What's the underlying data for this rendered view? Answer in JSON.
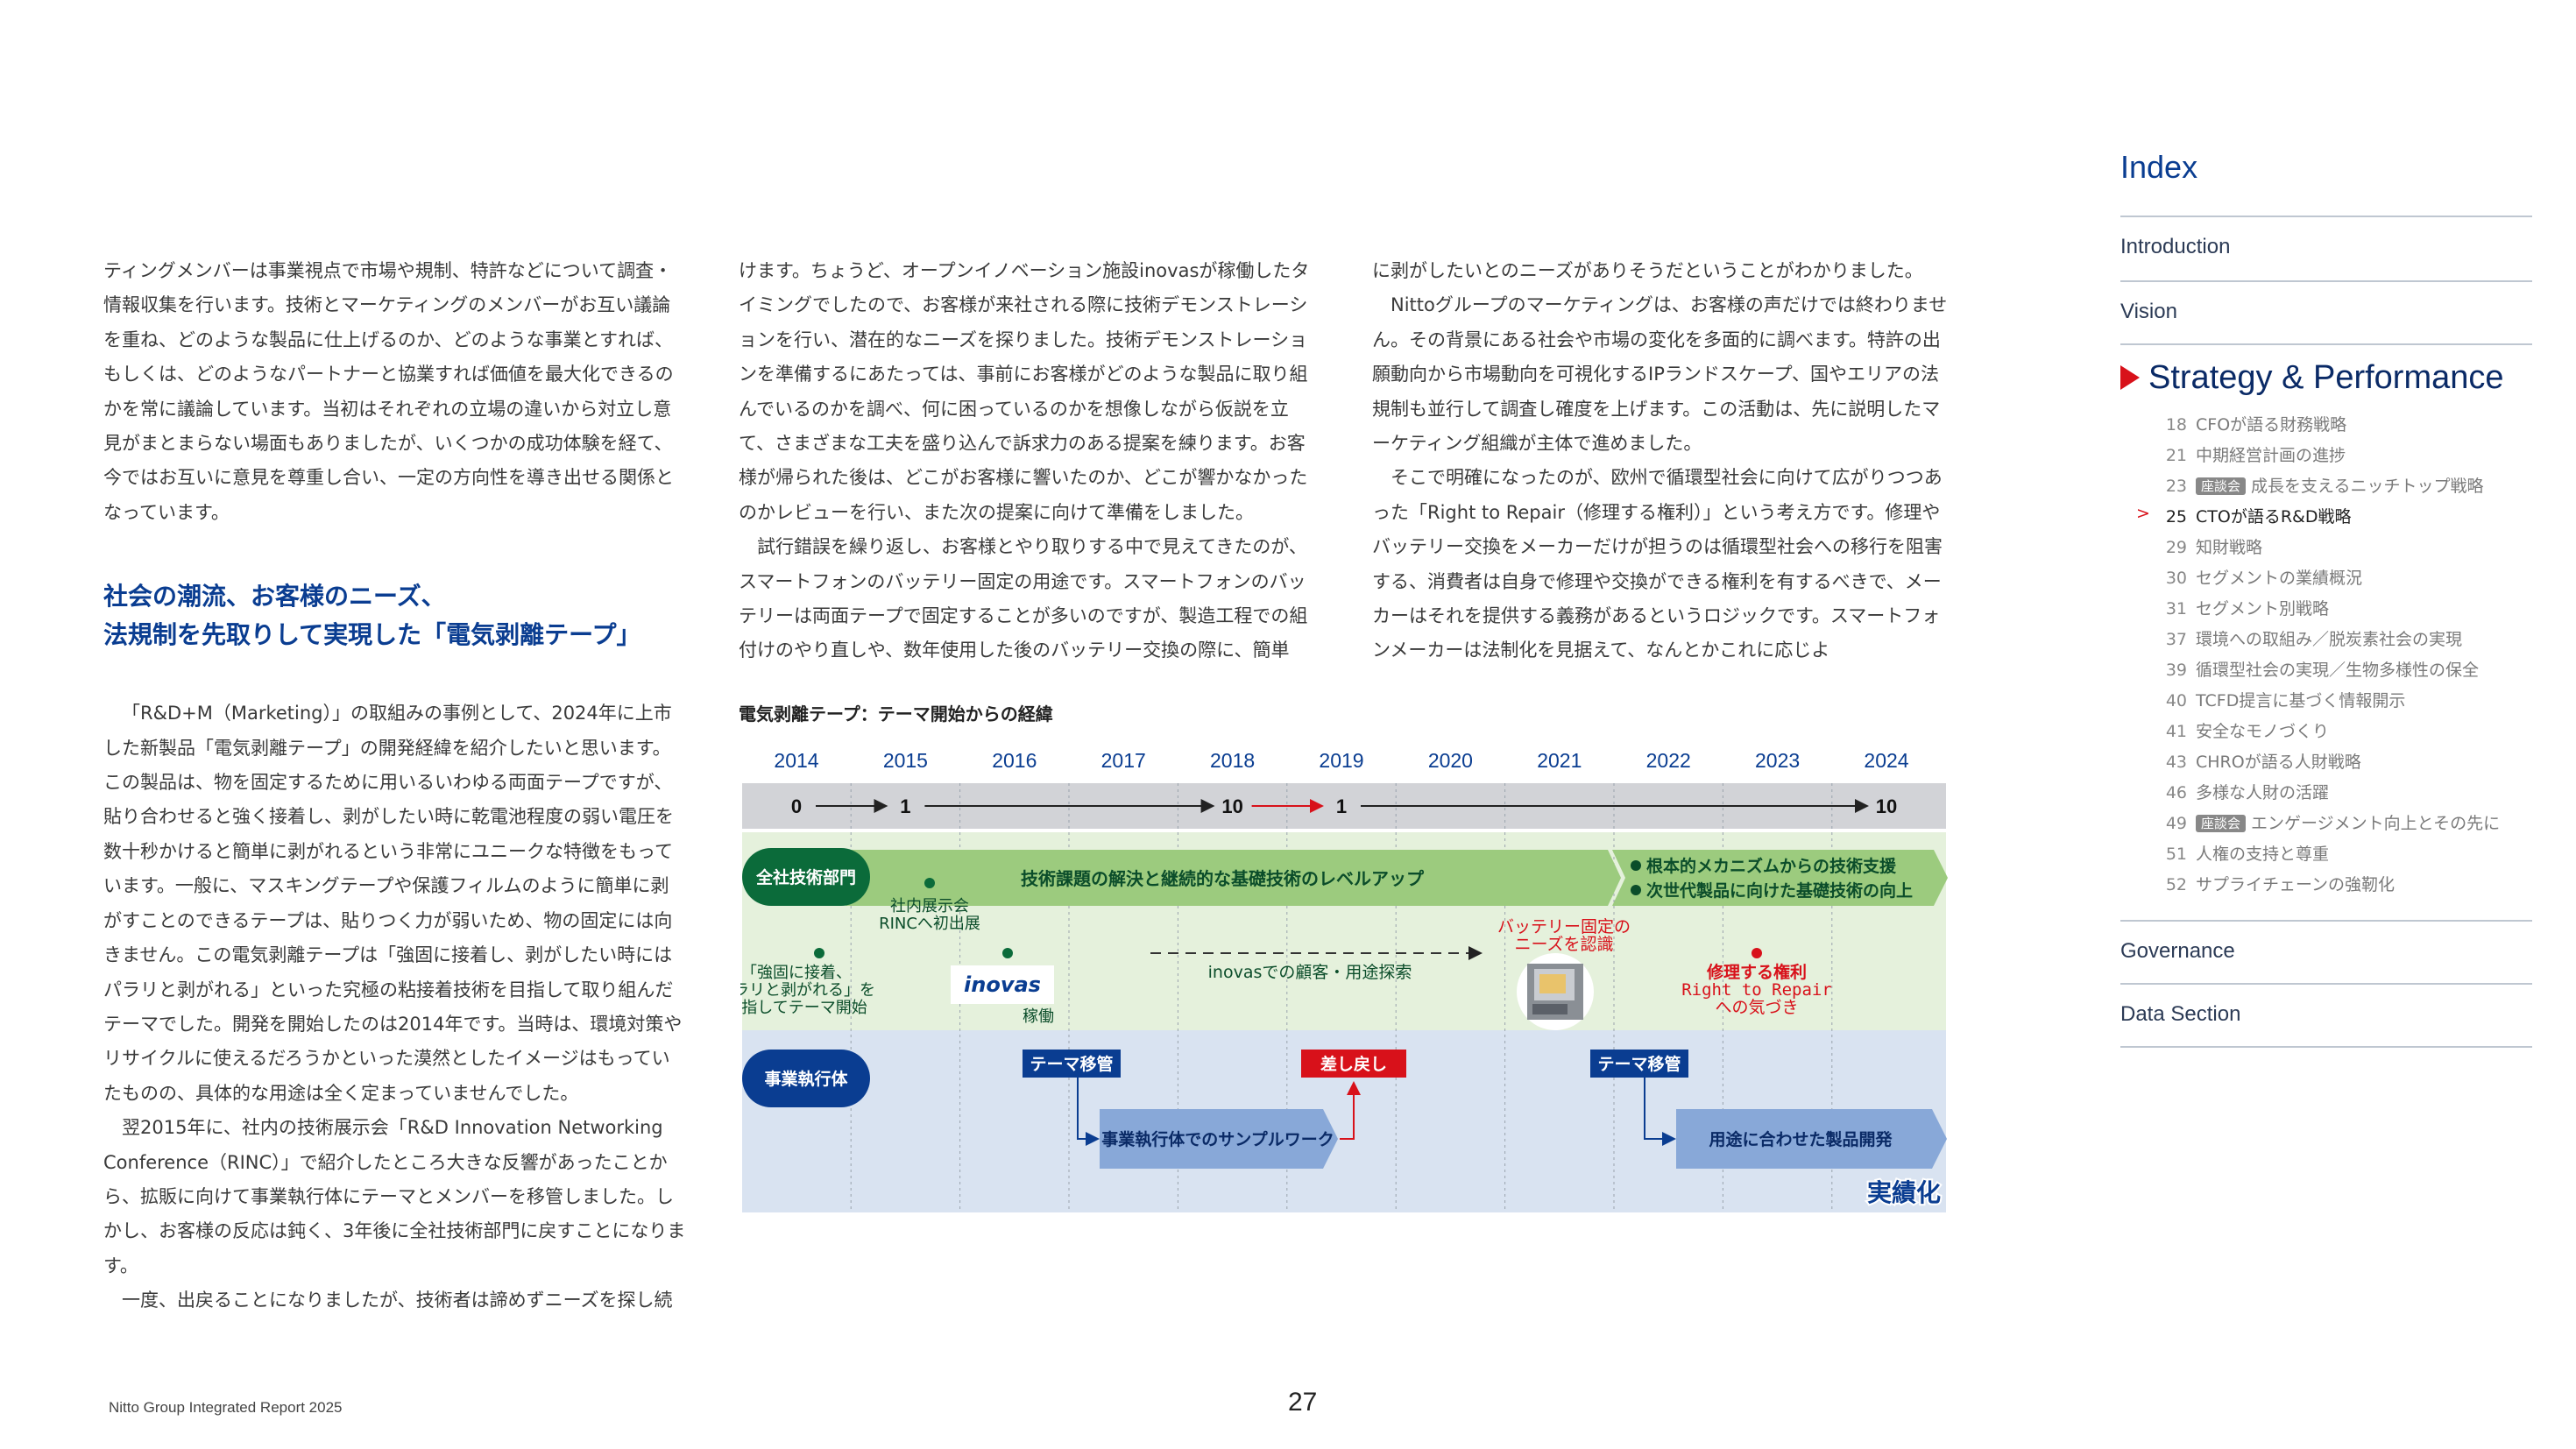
{
  "left_column": {
    "p1": "ティングメンバーは事業視点で市場や規制、特許などについて調査・情報収集を行います。技術とマーケティングのメンバーがお互い議論を重ね、どのような製品に仕上げるのか、どのような事業とすれば、もしくは、どのようなパートナーと協業すれば価値を最大化できるのかを常に議論しています。当初はそれぞれの立場の違いから対立し意見がまとまらない場面もありましたが、いくつかの成功体験を経て、今ではお互いに意見を尊重し合い、一定の方向性を導き出せる関係となっています。",
    "heading_line1": "社会の潮流、お客様のニーズ、",
    "heading_line2": "法規制を先取りして実現した「電気剥離テープ」",
    "p2": "「R&D+M（Marketing）」の取組みの事例として、2024年に上市した新製品「電気剥離テープ」の開発経緯を紹介したいと思います。この製品は、物を固定するために用いるいわゆる両面テープですが、貼り合わせると強く接着し、剥がしたい時に乾電池程度の弱い電圧を数十秒かけると簡単に剥がれるという非常にユニークな特徴をもっています。一般に、マスキングテープや保護フィルムのように簡単に剥がすことのできるテープは、貼りつく力が弱いため、物の固定には向きません。この電気剥離テープは「強固に接着し、剥がしたい時にはパラリと剥がれる」といった究極の粘接着技術を目指して取り組んだテーマでした。開発を開始したのは2014年です。当時は、環境対策やリサイクルに使えるだろうかといった漠然としたイメージはもっていたものの、具体的な用途は全く定まっていませんでした。",
    "p3": "翌2015年に、社内の技術展示会「R&D Innovation Networking Conference（RINC）」で紹介したところ大きな反響があったことから、拡販に向けて事業執行体にテーマとメンバーを移管しました。しかし、お客様の反応は鈍く、3年後に全社技術部門に戻すことになります。",
    "p4": "一度、出戻ることになりましたが、技術者は諦めずニーズを探し続"
  },
  "middle_column": {
    "p1": "けます。ちょうど、オープンイノベーション施設inovasが稼働したタイミングでしたので、お客様が来社される際に技術デモンストレーションを行い、潜在的なニーズを探りました。技術デモンストレーションを準備するにあたっては、事前にお客様がどのような製品に取り組んでいるのかを調べ、何に困っているのかを想像しながら仮説を立て、さまざまな工夫を盛り込んで訴求力のある提案を練ります。お客様が帰られた後は、どこがお客様に響いたのか、どこが響かなかったのかレビューを行い、また次の提案に向けて準備をしました。",
    "p2": "試行錯誤を繰り返し、お客様とやり取りする中で見えてきたのが、スマートフォンのバッテリー固定の用途です。スマートフォンのバッテリーは両面テープで固定することが多いのですが、製造工程での組付けのやり直しや、数年使用した後のバッテリー交換の際に、簡単"
  },
  "right_column": {
    "p1": "に剥がしたいとのニーズがありそうだということがわかりました。",
    "p2": "Nittoグループのマーケティングは、お客様の声だけでは終わりません。その背景にある社会や市場の変化を多面的に調べます。特許の出願動向から市場動向を可視化するIPランドスケープ、国やエリアの法規制も並行して調査し確度を上げます。この活動は、先に説明したマーケティング組織が主体で進めました。",
    "p3": "そこで明確になったのが、欧州で循環型社会に向けて広がりつつあった「Right to Repair（修理する権利）」という考え方です。修理やバッテリー交換をメーカーだけが担うのは循環型社会への移行を阻害する、消費者は自身で修理や交換ができる権利を有するべきで、メーカーはそれを提供する義務があるというロジックです。スマートフォンメーカーは法制化を見据えて、なんとかこれに応じよ"
  },
  "chart": {
    "title": "電気剥離テープ：テーマ開始からの経緯",
    "years": [
      "2014",
      "2015",
      "2016",
      "2017",
      "2018",
      "2019",
      "2020",
      "2021",
      "2022",
      "2023",
      "2024"
    ],
    "counts": [
      {
        "year": "2014",
        "value": "0"
      },
      {
        "year": "2015",
        "value": "1"
      },
      {
        "year": "2018",
        "value": "10"
      },
      {
        "year": "2019",
        "value": "1"
      },
      {
        "year": "2024",
        "value": "10"
      }
    ],
    "lane_corporate": "全社技術部門",
    "lane_business": "事業執行体",
    "banner_main": "技術課題の解決と継続的な基礎技術のレベルアップ",
    "banner_end_1": "根本的メカニズムからの技術支援",
    "banner_end_2": "次世代製品に向けた基礎技術の向上",
    "event_start_1": "「強固に接着、",
    "event_start_2": "パラリと剥がれる」を",
    "event_start_3": "目指してテーマ開始",
    "event_rinc_1": "社内展示会",
    "event_rinc_2": "RINCへ初出展",
    "inovas_logo": "inovas",
    "inovas_label": "稼働",
    "inovas_activity": "inovasでの顧客・用途探索",
    "battery_1": "バッテリー固定の",
    "battery_2": "ニーズを認識",
    "repair_1": "修理する権利",
    "repair_2": "Right to Repair",
    "repair_3": "への気づき",
    "transfer_1": "テーマ移管",
    "sendback": "差し戻し",
    "transfer_2": "テーマ移管",
    "sample_work": "事業執行体でのサンプルワーク",
    "product_dev": "用途に合わせた製品開発",
    "realized": "実績化",
    "colors": {
      "blue": "#0a3d91",
      "red": "#d8111a",
      "green_dark": "#0b6b3a",
      "green_band": "#e5f1dc",
      "blue_band": "#d9e3f1",
      "header_band": "#d2d3d7"
    }
  },
  "index": {
    "title": "Index",
    "introduction": "Introduction",
    "vision": "Vision",
    "strategy": "Strategy & Performance",
    "subitems": [
      {
        "num": "18",
        "label": "CFOが語る財務戦略",
        "tag": ""
      },
      {
        "num": "21",
        "label": "中期経営計画の進捗",
        "tag": ""
      },
      {
        "num": "23",
        "label": "成長を支えるニッチトップ戦略",
        "tag": "座談会"
      },
      {
        "num": "25",
        "label": "CTOが語るR&D戦略",
        "tag": "",
        "current": true
      },
      {
        "num": "29",
        "label": "知財戦略",
        "tag": ""
      },
      {
        "num": "30",
        "label": "セグメントの業績概況",
        "tag": ""
      },
      {
        "num": "31",
        "label": "セグメント別戦略",
        "tag": ""
      },
      {
        "num": "37",
        "label": "環境への取組み／脱炭素社会の実現",
        "tag": ""
      },
      {
        "num": "39",
        "label": "循環型社会の実現／生物多様性の保全",
        "tag": ""
      },
      {
        "num": "40",
        "label": "TCFD提言に基づく情報開示",
        "tag": ""
      },
      {
        "num": "41",
        "label": "安全なモノづくり",
        "tag": ""
      },
      {
        "num": "43",
        "label": "CHROが語る人財戦略",
        "tag": ""
      },
      {
        "num": "46",
        "label": "多様な人財の活躍",
        "tag": ""
      },
      {
        "num": "49",
        "label": "エンゲージメント向上とその先に",
        "tag": "座談会"
      },
      {
        "num": "51",
        "label": "人権の支持と尊重",
        "tag": ""
      },
      {
        "num": "52",
        "label": "サプライチェーンの強靭化",
        "tag": ""
      }
    ],
    "current_marker": ">",
    "governance": "Governance",
    "data_section": "Data Section"
  },
  "footer": {
    "report": "Nitto Group Integrated Report 2025",
    "page": "27"
  }
}
